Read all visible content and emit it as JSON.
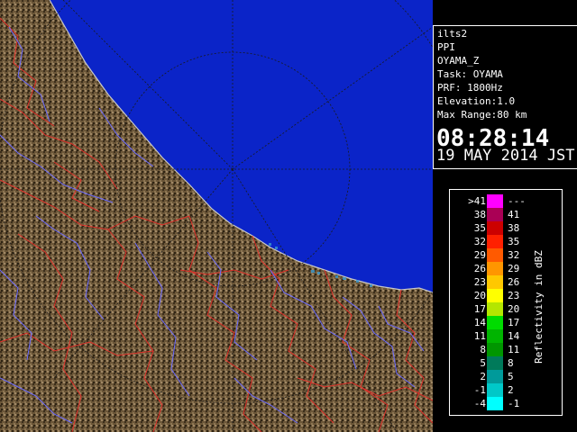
{
  "info": {
    "lines": [
      "ilts2",
      "PPI",
      "OYAMA_Z",
      "Task: OYAMA",
      "PRF: 1800Hz",
      "Elevation:1.0",
      "Max Range:80 km"
    ],
    "time": "08:28:14",
    "date": "19 MAY 2014 JST"
  },
  "legend": {
    "title": "Reflectivity in dBZ",
    "rows": [
      {
        "lo": ">41",
        "hi": "---",
        "color": "#ff00ff"
      },
      {
        "lo": "38",
        "hi": "41",
        "color": "#aa0055"
      },
      {
        "lo": "35",
        "hi": "38",
        "color": "#cc0000"
      },
      {
        "lo": "32",
        "hi": "35",
        "color": "#ff2000"
      },
      {
        "lo": "29",
        "hi": "32",
        "color": "#ff5a00"
      },
      {
        "lo": "26",
        "hi": "29",
        "color": "#ff9600"
      },
      {
        "lo": "23",
        "hi": "26",
        "color": "#ffc800"
      },
      {
        "lo": "20",
        "hi": "23",
        "color": "#ffff00"
      },
      {
        "lo": "17",
        "hi": "20",
        "color": "#b4e600"
      },
      {
        "lo": "14",
        "hi": "17",
        "color": "#00dc00"
      },
      {
        "lo": "11",
        "hi": "14",
        "color": "#00b400"
      },
      {
        "lo": "8",
        "hi": "11",
        "color": "#009600"
      },
      {
        "lo": "5",
        "hi": "8",
        "color": "#007a5a"
      },
      {
        "lo": "2",
        "hi": "5",
        "color": "#009a9a"
      },
      {
        "lo": "-1",
        "hi": "2",
        "color": "#00c8c8"
      },
      {
        "lo": "-4",
        "hi": "-1",
        "color": "#00ffff"
      }
    ]
  },
  "colors": {
    "sea": "#0b24c8",
    "land": "#6b5638",
    "rivers": "#6b6bff",
    "borders": "#e0302a",
    "range_rings": "#202020"
  }
}
